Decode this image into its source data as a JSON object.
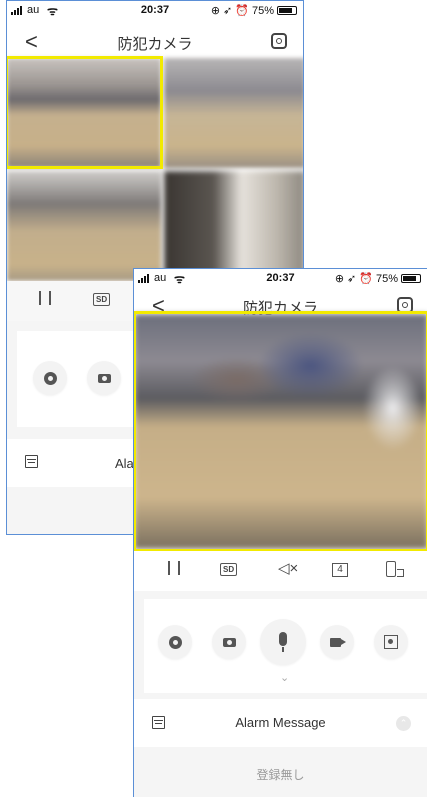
{
  "status_bar": {
    "carrier": "au",
    "time": "20:37",
    "battery": "75%",
    "battery_level": 0.75,
    "icons": [
      "signal-icon",
      "wifi-icon",
      "lock-rotation-icon",
      "location-icon",
      "alarm-icon",
      "battery-icon"
    ]
  },
  "nav": {
    "back_label": "<",
    "title": "防犯カメラ"
  },
  "back_screen": {
    "grid_view_count": 4,
    "alarm_label_partial": "Ala"
  },
  "front_screen": {
    "controls": {
      "sd_label": "SD",
      "mute_label": "◁×",
      "split_label": "4"
    },
    "actions": [
      "ptz-icon",
      "snapshot-icon",
      "mic-icon",
      "record-icon",
      "screenshot-icon"
    ],
    "expand_glyph": "⌄",
    "alarm_message_label": "Alarm Message",
    "alarm_toggle_glyph": "⌃",
    "empty_label": "登録無し"
  },
  "colors": {
    "selection": "#f2ea00",
    "phone_border": "#5b8fd6"
  }
}
